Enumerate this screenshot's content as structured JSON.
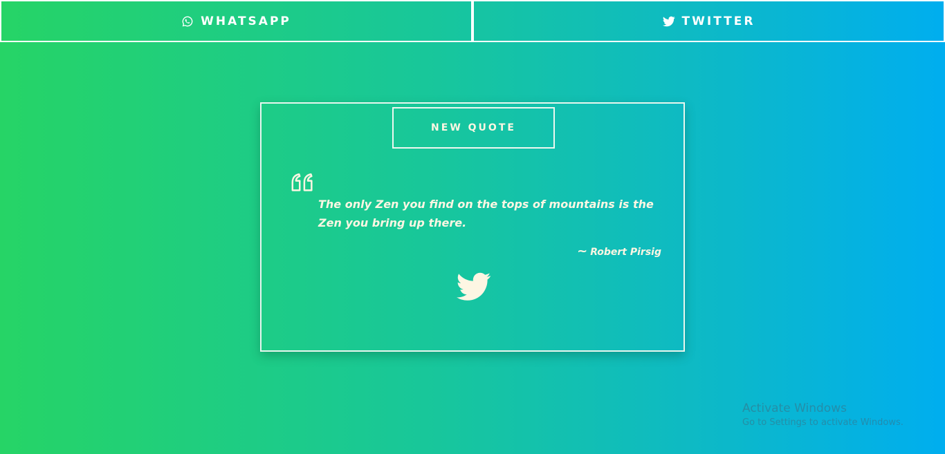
{
  "share_bar": {
    "whatsapp": {
      "label": "WHATSAPP",
      "icon": "whatsapp-icon"
    },
    "twitter": {
      "label": "TWITTER",
      "icon": "twitter-icon"
    }
  },
  "quote_card": {
    "new_quote_label": "NEW QUOTE",
    "quote_icon": "quote-left-icon",
    "text": "The only Zen you find on the tops of mountains is the Zen you bring up there.",
    "author_prefix": "~",
    "author": "Robert Pirsig",
    "tweet_icon": "twitter-icon"
  },
  "watermark": {
    "title": "Activate Windows",
    "subtitle": "Go to Settings to activate Windows."
  },
  "colors": {
    "gradient_start": "#26d466",
    "gradient_end": "#00aeef",
    "text_cream": "#fdf6e3",
    "border": "#ffffff"
  }
}
